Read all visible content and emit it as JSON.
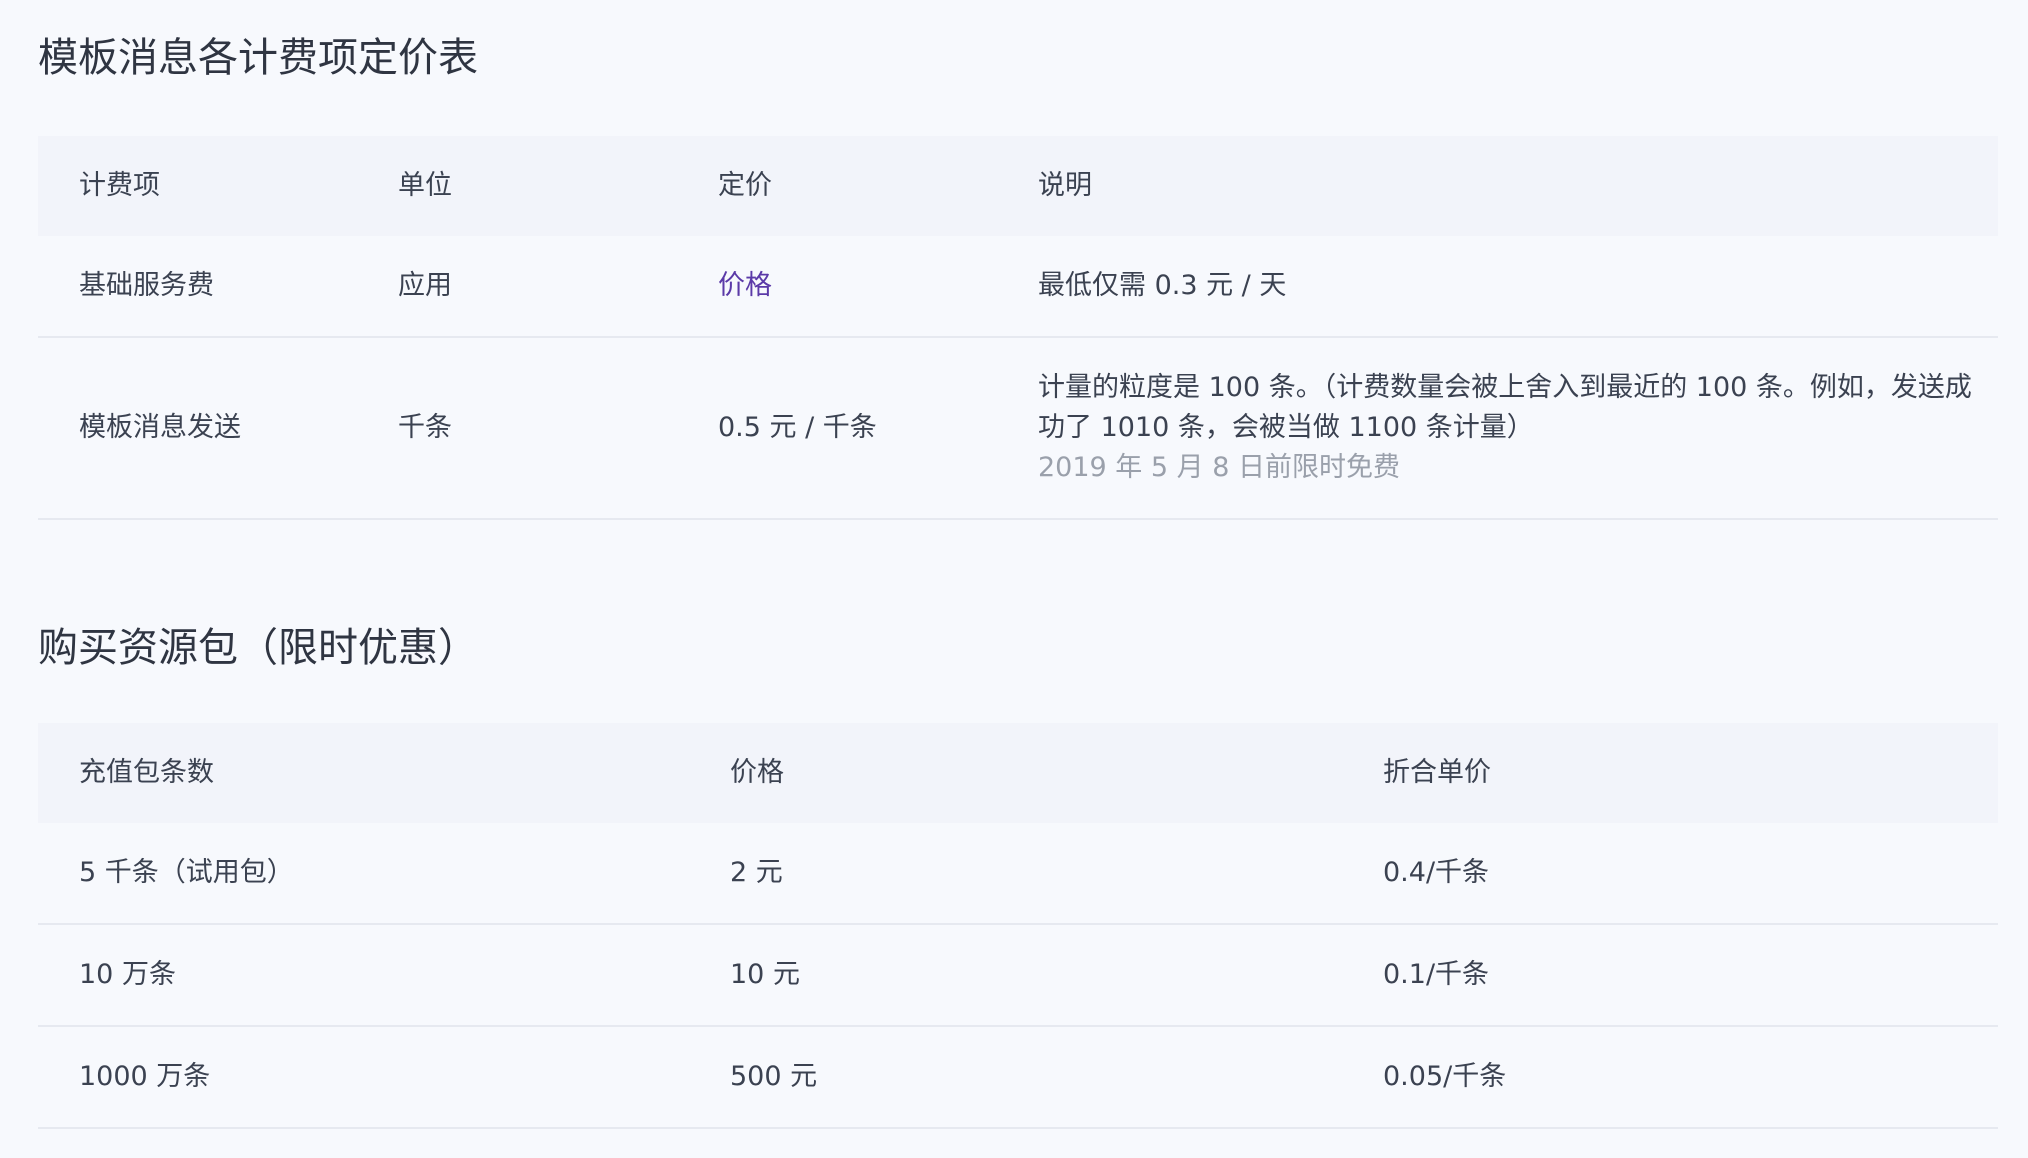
{
  "pricing": {
    "title": "模板消息各计费项定价表",
    "headers": [
      "计费项",
      "单位",
      "定价",
      "说明"
    ],
    "rows": [
      {
        "item": "基础服务费",
        "unit": "应用",
        "price": "价格",
        "note": "最低仅需 0.3 元 / 天"
      },
      {
        "item": "模板消息发送",
        "unit": "千条",
        "price": "0.5 元 / 千条",
        "note": "计量的粒度是 100 条。（计费数量会被上舍入到最近的 100 条。例如，发送成功了 1010 条，会被当做 1100 条计量）",
        "note_sub": "2019 年 5 月 8 日前限时免费"
      }
    ]
  },
  "packages": {
    "title": "购买资源包（限时优惠）",
    "headers": [
      "充值包条数",
      "价格",
      "折合单价"
    ],
    "rows": [
      {
        "count": "5 千条（试用包）",
        "price": "2 元",
        "unit_price": "0.4/千条"
      },
      {
        "count": "10 万条",
        "price": "10 元",
        "unit_price": "0.1/千条"
      },
      {
        "count": "1000 万条",
        "price": "500 元",
        "unit_price": "0.05/千条"
      }
    ]
  }
}
